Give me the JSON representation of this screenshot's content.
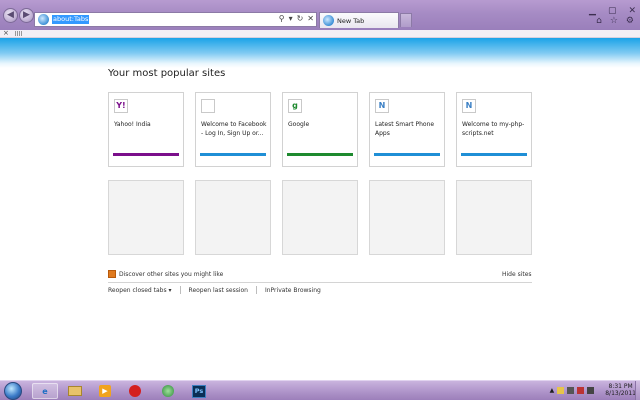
{
  "browser": {
    "address": "about:Tabs",
    "tab_title": "New Tab",
    "icons": {
      "back": "back-arrow-icon",
      "forward": "forward-arrow-icon",
      "search": "search-icon",
      "refresh": "refresh-icon",
      "stop": "close-icon",
      "home": "home-icon",
      "favorites": "star-icon",
      "tools": "gear-icon"
    }
  },
  "newtab": {
    "heading": "Your most popular sites",
    "tiles": [
      {
        "label": "Yahoo! India",
        "favicon": "Y!",
        "color": "#7b0f8b"
      },
      {
        "label": "Welcome to Facebook - Log In, Sign Up or...",
        "favicon": "",
        "color": "#1f8fd6"
      },
      {
        "label": "Google",
        "favicon": "g",
        "color": "#1e8a2f"
      },
      {
        "label": "Latest Smart Phone Apps",
        "favicon": "N",
        "color": "#1f8fd6"
      },
      {
        "label": "Welcome to my-php-scripts.net",
        "favicon": "N",
        "color": "#1f8fd6"
      }
    ],
    "discover": "Discover other sites you might like",
    "hide_sites": "Hide sites",
    "reopen_tabs": "Reopen closed tabs",
    "reopen_session": "Reopen last session",
    "inprivate": "InPrivate Browsing"
  },
  "taskbar": {
    "apps": [
      "internet-explorer",
      "windows-explorer",
      "media-player",
      "opera",
      "network-app",
      "photoshop"
    ],
    "photoshop_label": "Ps",
    "time": "8:31 PM",
    "date": "8/13/2011"
  }
}
